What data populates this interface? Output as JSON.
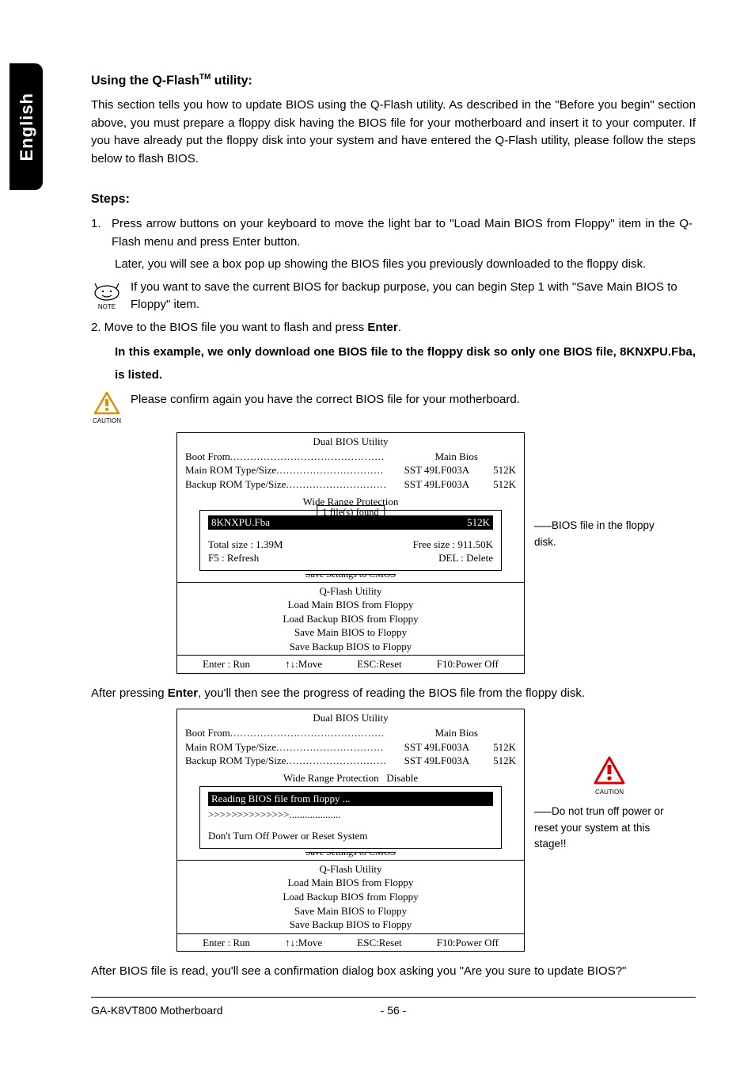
{
  "sideTab": "English",
  "heading1_pre": "Using the Q-Flash",
  "heading1_tm": "TM",
  "heading1_post": " utility:",
  "intro": "This section tells you how to update BIOS using the Q-Flash utility. As described in the \"Before you begin\" section above, you must prepare a floppy disk having the BIOS file for your motherboard and insert it to your computer. If you have already put the floppy disk into your system and have entered the Q-Flash utility, please follow the steps below to flash BIOS.",
  "stepsLabel": "Steps:",
  "step1_num": "1.",
  "step1a": "Press arrow buttons on your keyboard to move the light bar to \"Load Main BIOS from Floppy\" item in the Q-Flash menu and press Enter button.",
  "step1b": "Later, you will see a box pop up showing the BIOS files you previously downloaded to the floppy disk.",
  "noteLabel": "NOTE",
  "noteText": "If you want to save the current BIOS for backup purpose, you can begin Step 1 with \"Save Main BIOS to Floppy\" item.",
  "step2_pre": "2. Move to the BIOS file you want to flash and press ",
  "step2_bold": "Enter",
  "step2_post": ".",
  "boldLine": "In this example, we only download one BIOS file to the floppy disk so only one BIOS file, 8KNXPU.Fba, is listed.",
  "cautionLabel": "CAUTION",
  "cautionText": "Please confirm again you have the correct BIOS file for your motherboard.",
  "bios": {
    "title": "Dual BIOS Utility",
    "bootFromLabel": "Boot From",
    "bootFromVal": "Main Bios",
    "mainRomLabel": "Main ROM Type/Size",
    "mainRomVal": "SST 49LF003A",
    "mainRomSize": "512K",
    "backupRomLabel": "Backup ROM Type/Size",
    "backupRomVal": "SST 49LF003A",
    "backupRomSize": "512K",
    "wideRangeLabel": "Wide Range Protection",
    "wideRangeVal": "Disable",
    "filesFound": "1 file(s) found",
    "fileName": "8KNXPU.Fba",
    "fileSize": "512K",
    "totalSize": "Total size : 1.39M",
    "freeSize": "Free size : 911.50K",
    "f5": "F5 : Refresh",
    "del": "DEL : Delete",
    "saveSettings": "Save Settings to CMOS",
    "subTitle": "Q-Flash Utility",
    "menu1": "Load Main BIOS from Floppy",
    "menu2": "Load Backup BIOS from Floppy",
    "menu3": "Save Main BIOS to Floppy",
    "menu4": "Save Backup BIOS to Floppy",
    "keyEnter": "Enter : Run",
    "keyMove": "↑↓:Move",
    "keyEsc": "ESC:Reset",
    "keyF10": "F10:Power Off",
    "reading": "Reading BIOS file from floppy ...",
    "progress": ">>>>>>>>>>>>>>....................",
    "warn": "Don't Turn Off Power or Reset System"
  },
  "annot1": "BIOS file in the floppy disk.",
  "afterPress_pre": "After pressing ",
  "afterPress_bold": "Enter",
  "afterPress_post": ", you'll then see the progress of reading the BIOS file from the floppy disk.",
  "annot2": "Do not trun off power or reset your system at this stage!!",
  "afterRead": "After BIOS file is read, you'll see a confirmation dialog box asking you \"Are you sure to update BIOS?\"",
  "footerLeft": "GA-K8VT800 Motherboard",
  "footerCenter": "- 56 -"
}
